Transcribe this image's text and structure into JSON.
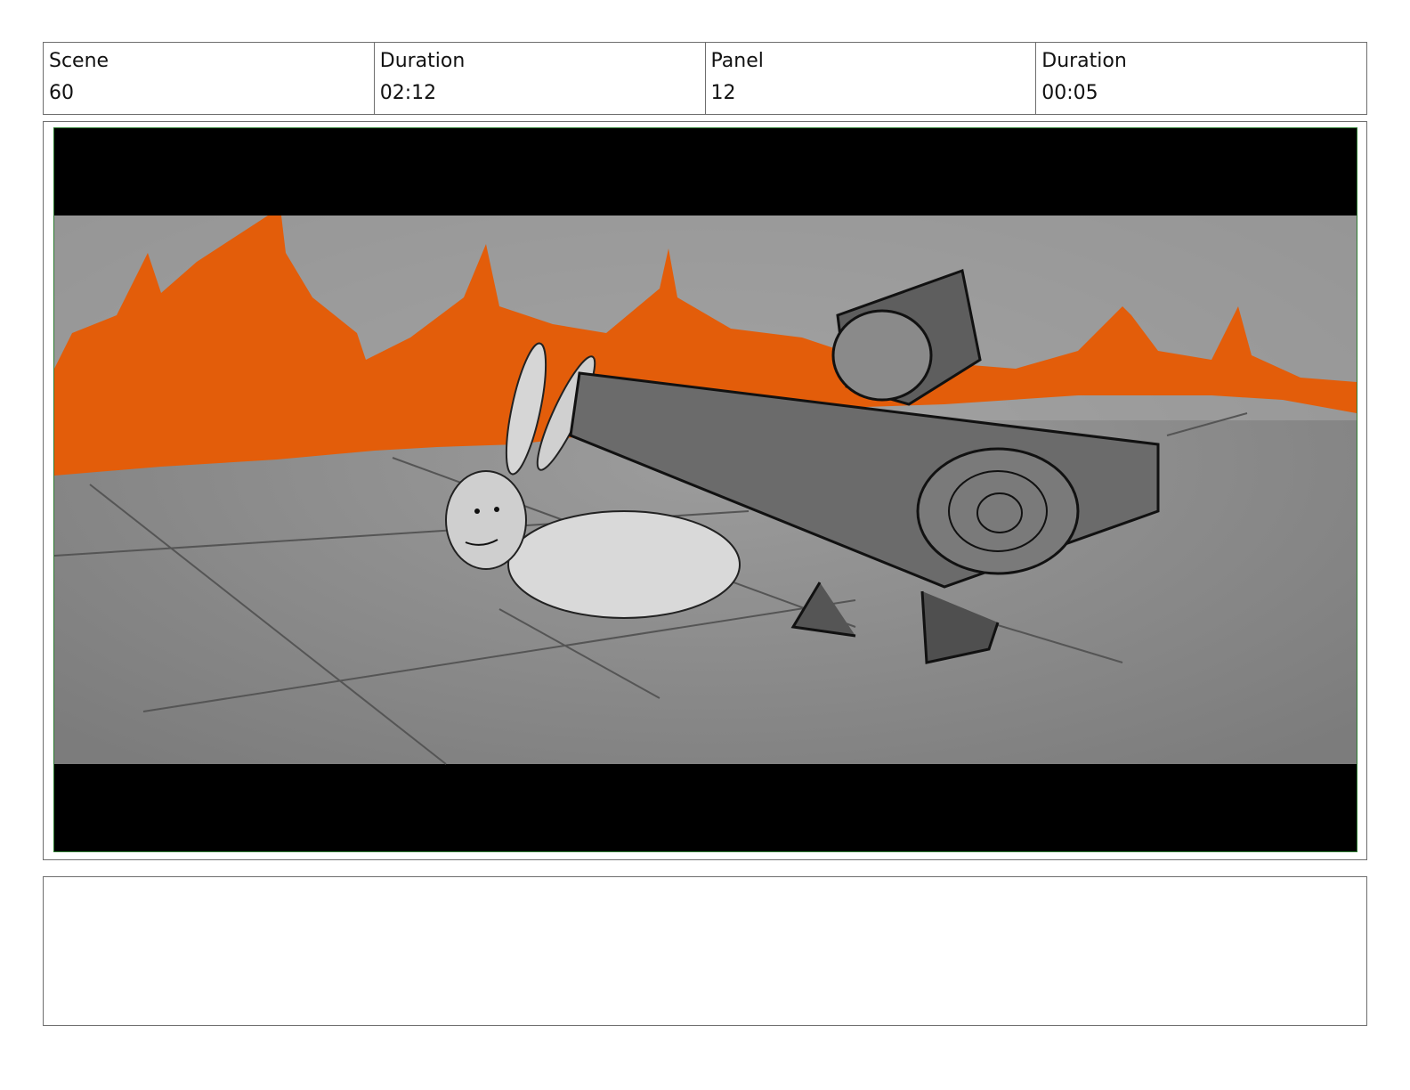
{
  "header": {
    "scene_label": "Scene",
    "scene_value": "60",
    "scene_duration_label": "Duration",
    "scene_duration_value": "02:12",
    "panel_label": "Panel",
    "panel_value": "12",
    "panel_duration_label": "Duration",
    "panel_duration_value": "00:05"
  },
  "panel": {
    "frame_border_color": "#2e7d32",
    "palette": {
      "lava": "#e35d0a",
      "ground": "#8f8f8f",
      "sky": "#a9a9a9",
      "letterbox": "#000000"
    }
  },
  "notes": {
    "text": ""
  }
}
